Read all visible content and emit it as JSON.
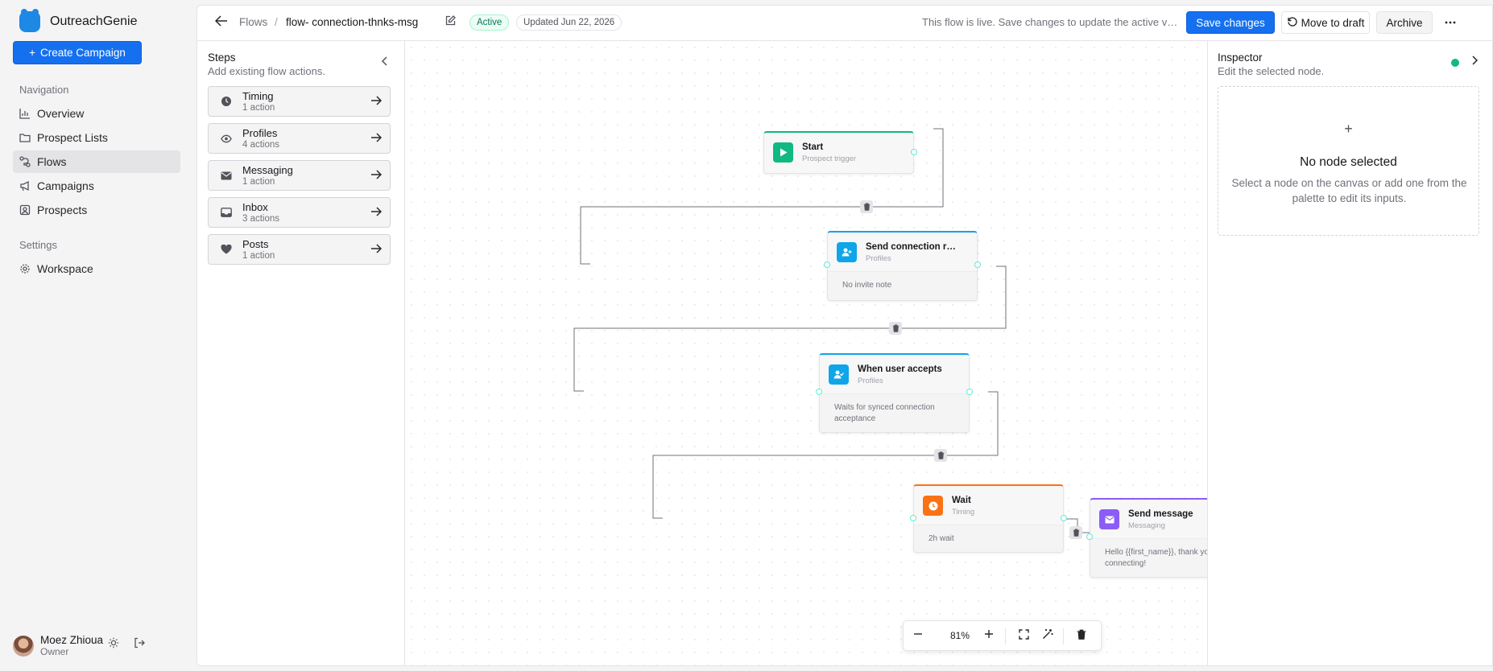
{
  "app": {
    "name": "OutreachGenie"
  },
  "sidebar": {
    "create_label": "Create Campaign",
    "nav_section": "Navigation",
    "nav": [
      {
        "label": "Overview",
        "icon": "bar-chart-icon"
      },
      {
        "label": "Prospect Lists",
        "icon": "folder-icon"
      },
      {
        "label": "Flows",
        "icon": "flow-icon"
      },
      {
        "label": "Campaigns",
        "icon": "megaphone-icon"
      },
      {
        "label": "Prospects",
        "icon": "contact-icon"
      }
    ],
    "settings_section": "Settings",
    "settings": [
      {
        "label": "Workspace",
        "icon": "gear-icon"
      }
    ],
    "user": {
      "name": "Moez Zhioua",
      "role": "Owner"
    }
  },
  "header": {
    "crumb_root": "Flows",
    "crumb_sep": "/",
    "flow_name": "flow- connection-thnks-msg",
    "status": "Active",
    "updated": "Updated Jun 22, 2026",
    "live_text": "This flow is live. Save changes to update the active version.",
    "save_label": "Save changes",
    "draft_label": "Move to draft",
    "archive_label": "Archive"
  },
  "steps": {
    "title": "Steps",
    "subtitle": "Add existing flow actions.",
    "items": [
      {
        "name": "Timing",
        "count": "1 action",
        "icon": "clock-icon"
      },
      {
        "name": "Profiles",
        "count": "4 actions",
        "icon": "eye-icon"
      },
      {
        "name": "Messaging",
        "count": "1 action",
        "icon": "mail-icon"
      },
      {
        "name": "Inbox",
        "count": "3 actions",
        "icon": "inbox-icon"
      },
      {
        "name": "Posts",
        "count": "1 action",
        "icon": "heart-icon"
      }
    ]
  },
  "canvas": {
    "nodes": [
      {
        "title": "Start",
        "category": "Prospect trigger",
        "body": "",
        "accent": "#10b981",
        "icon": "play-icon"
      },
      {
        "title": "Send connection request",
        "category": "Profiles",
        "body": "No invite note",
        "accent": "#0ea5e9",
        "icon": "user-plus-icon"
      },
      {
        "title": "When user accepts",
        "category": "Profiles",
        "body": "Waits for synced connection acceptance",
        "accent": "#0ea5e9",
        "icon": "user-check-icon"
      },
      {
        "title": "Wait",
        "category": "Timing",
        "body": "2h wait",
        "accent": "#f97316",
        "icon": "clock-icon"
      },
      {
        "title": "Send message",
        "category": "Messaging",
        "body": "Hello {{first_name}}, thank you for connecting!",
        "accent": "#8b5cf6",
        "icon": "mail-icon"
      }
    ],
    "zoom": "81%"
  },
  "inspector": {
    "title": "Inspector",
    "subtitle": "Edit the selected node.",
    "empty_title": "No node selected",
    "empty_text": "Select a node on the canvas or add one from the palette to edit its inputs."
  },
  "colors": {
    "primary": "#1570ef",
    "status_live": "#10b981"
  }
}
